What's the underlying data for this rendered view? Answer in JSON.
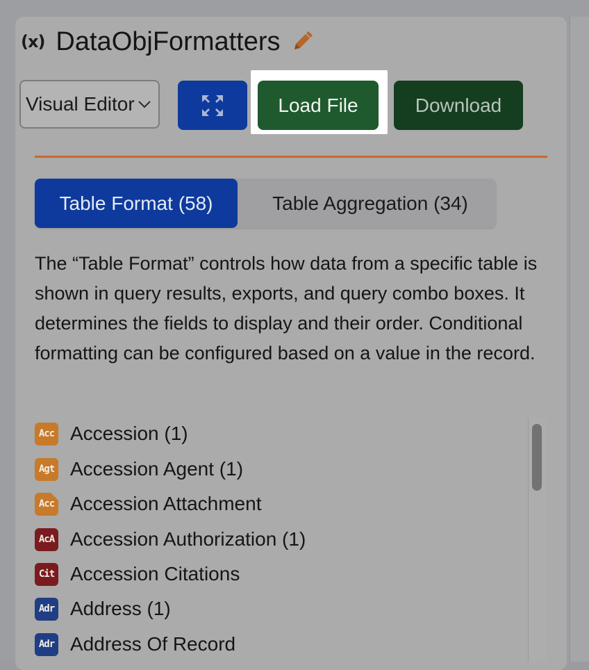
{
  "header": {
    "var_icon": "(x)",
    "title": "DataObjFormatters"
  },
  "toolbar": {
    "editor_select": "Visual Editor",
    "load_label": "Load File",
    "download_label": "Download"
  },
  "tabs": [
    {
      "label": "Table Format (58)",
      "active": true
    },
    {
      "label": "Table Aggregation (34)",
      "active": false
    }
  ],
  "description": "The “Table Format” controls how data from a specific table is shown in query results, exports, and query combo boxes. It determines the fields to display and their order. Conditional formatting can be configured based on a value in the record.",
  "items": [
    {
      "badge": "Acc",
      "color": "orange",
      "label": "Accession (1)"
    },
    {
      "badge": "Agt",
      "color": "orange",
      "label": "Accession Agent (1)"
    },
    {
      "badge": "Acc",
      "color": "orange",
      "label": "Accession Attachment",
      "folded": true
    },
    {
      "badge": "AcA",
      "color": "red",
      "label": "Accession Authorization (1)"
    },
    {
      "badge": "Cit",
      "color": "red",
      "label": "Accession Citations"
    },
    {
      "badge": "Adr",
      "color": "blue",
      "label": "Address (1)"
    },
    {
      "badge": "Adr",
      "color": "blue",
      "label": "Address Of Record"
    }
  ],
  "colors": {
    "primary_blue": "#0e3a9d",
    "load_green": "#1e5a2d",
    "download_green": "#153d1f",
    "accent_orange": "#c8682a"
  }
}
